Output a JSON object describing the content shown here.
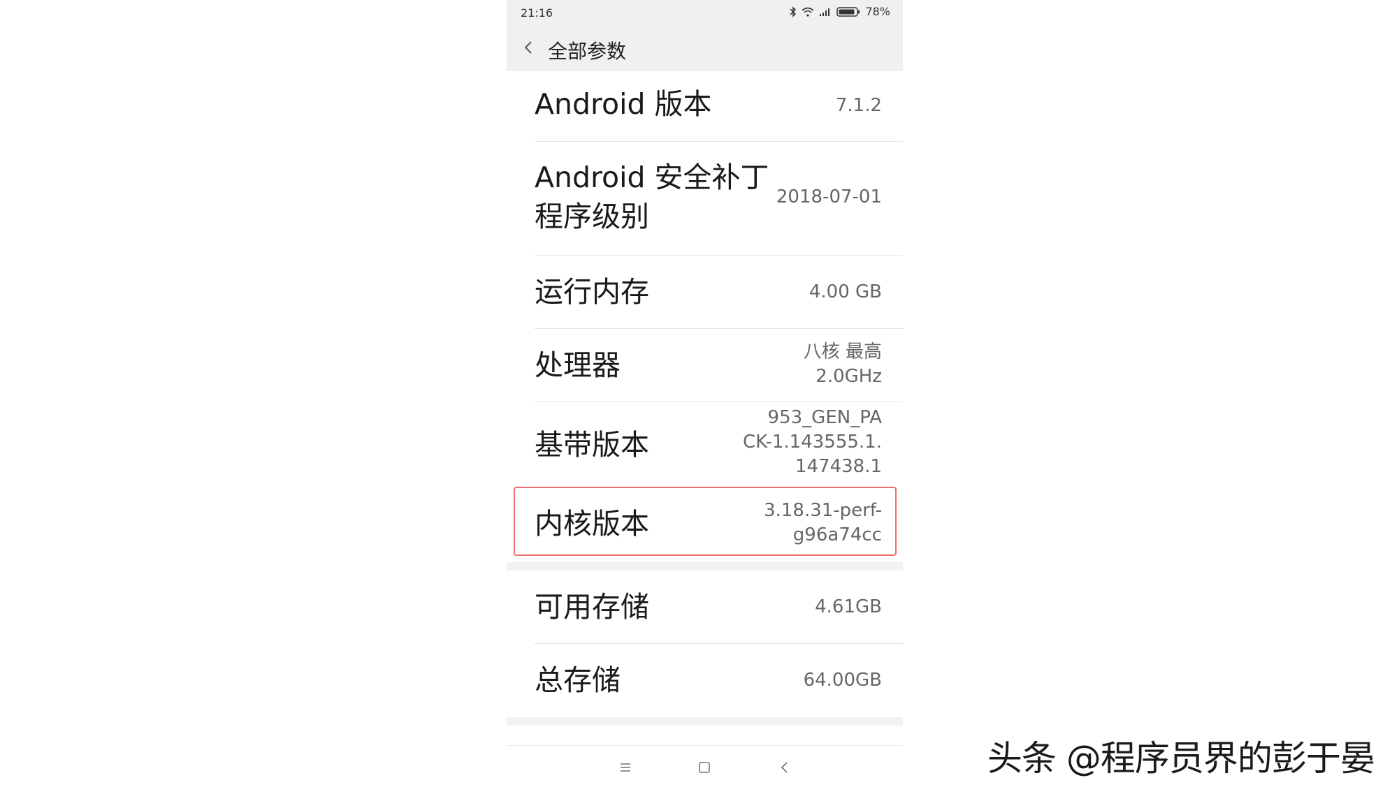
{
  "status_bar": {
    "time": "21:16",
    "battery_percent": "78%",
    "icons": [
      "bluetooth-icon",
      "wifi-icon",
      "signal-icon",
      "battery-icon"
    ]
  },
  "app_bar": {
    "title": "全部参数"
  },
  "rows": [
    {
      "label": "Android 版本",
      "value": "7.1.2"
    },
    {
      "label": "Android 安全补丁\n程序级别",
      "value": "2018-07-01"
    },
    {
      "label": "运行内存",
      "value": "4.00 GB"
    },
    {
      "label": "处理器",
      "value": "八核 最高\n2.0GHz"
    },
    {
      "label": "基带版本",
      "value": "953_GEN_PA\nCK-1.143555.1.\n147438.1"
    },
    {
      "label": "内核版本",
      "value": "3.18.31-perf-\ng96a74cc"
    },
    {
      "label": "可用存储",
      "value": "4.61GB"
    },
    {
      "label": "总存储",
      "value": "64.00GB"
    }
  ],
  "nav_bar": {
    "icons": [
      "menu-icon",
      "home-icon",
      "back-icon"
    ]
  },
  "watermark": "头条 @程序员界的彭于晏",
  "colors": {
    "highlight_border": "#f26d6d",
    "app_bar_bg": "#f0f0f0"
  }
}
